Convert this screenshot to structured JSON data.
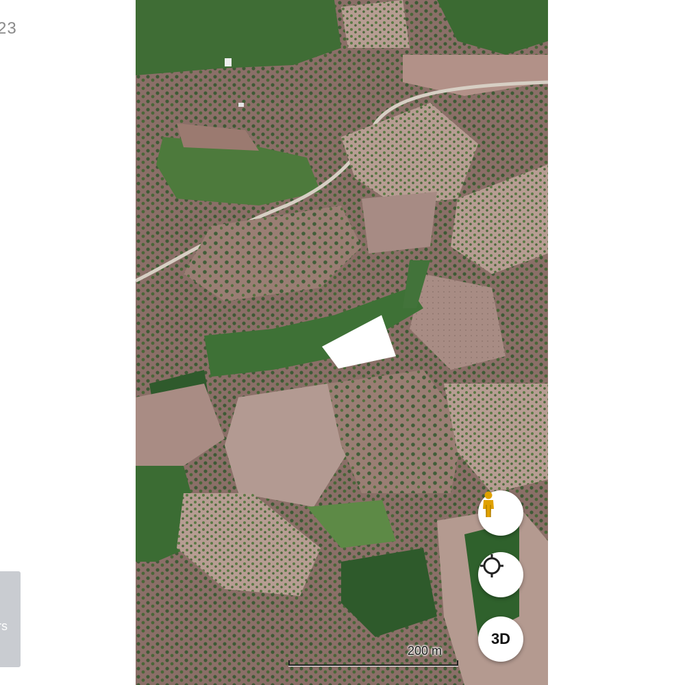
{
  "left_panel": {
    "date_fragment": "23",
    "layers_tab_label": "rs"
  },
  "map": {
    "view": "satellite",
    "marked_plot_color": "#ffffff",
    "scale_label": "200 m"
  },
  "controls": {
    "pegman_icon": "street-view-person-icon",
    "locate_icon": "my-location-crosshair-icon",
    "three_d_label": "3D"
  },
  "colors": {
    "pegman": "#e0a100",
    "button_bg": "#ffffff",
    "layers_tab": "#c9ccd1"
  }
}
